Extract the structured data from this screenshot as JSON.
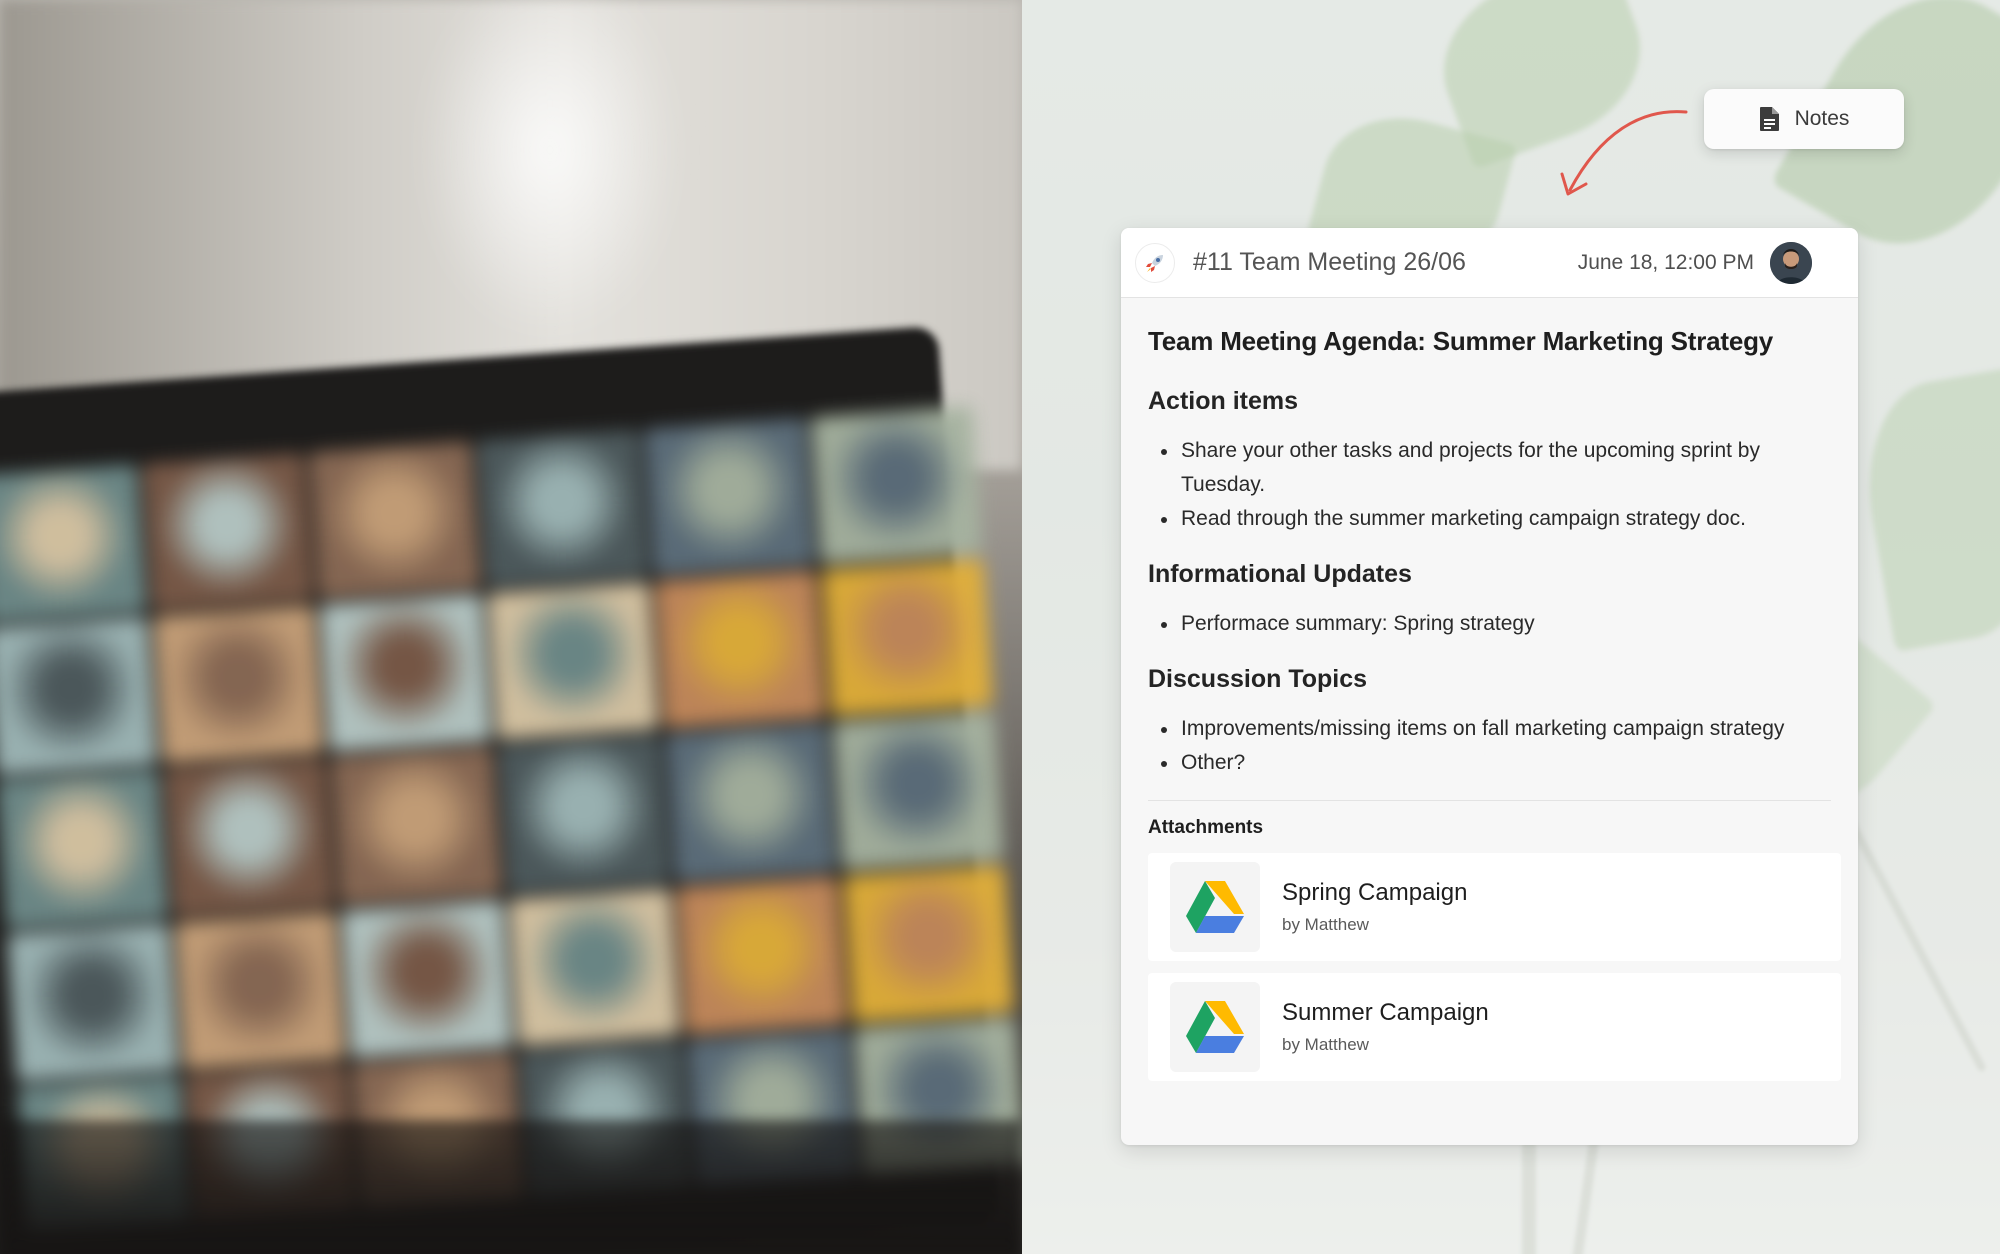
{
  "notes_button": {
    "label": "Notes",
    "icon": "document-icon"
  },
  "meeting": {
    "title": "#11 Team Meeting 26/06",
    "date": "June 18,  12:00 PM",
    "icon": "rocket-icon"
  },
  "agenda": {
    "title": "Team Meeting Agenda: Summer Marketing Strategy",
    "sections": [
      {
        "heading": "Action items",
        "items": [
          "Share your other tasks and projects for the upcoming sprint by Tuesday.",
          "Read through the summer marketing campaign strategy doc."
        ]
      },
      {
        "heading": "Informational Updates",
        "items": [
          "Performace summary: Spring strategy"
        ]
      },
      {
        "heading": "Discussion Topics",
        "items": [
          "Improvements/missing items on fall marketing campaign strategy",
          "Other?"
        ]
      }
    ]
  },
  "attachments": {
    "label": "Attachments",
    "items": [
      {
        "name": "Spring Campaign",
        "author": "by Matthew",
        "icon": "google-drive-icon"
      },
      {
        "name": "Summer Campaign",
        "author": "by Matthew",
        "icon": "google-drive-icon"
      }
    ]
  },
  "colors": {
    "arrow": "#e0574c",
    "card_background": "#f7f7f7",
    "drive_green": "#1ea362",
    "drive_yellow": "#ffba00",
    "drive_blue": "#4a7ee0"
  }
}
